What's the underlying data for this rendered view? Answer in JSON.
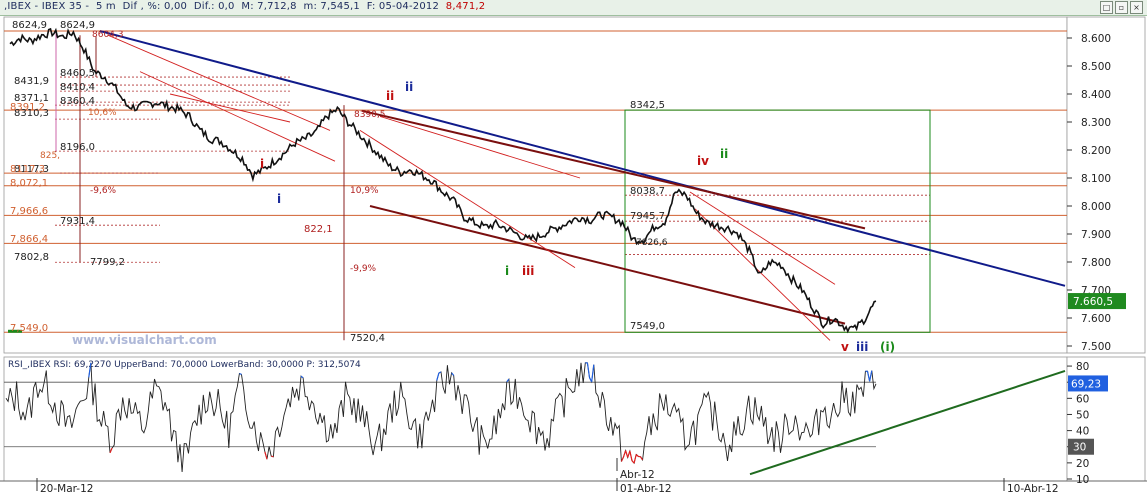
{
  "header": {
    "symbol": ",IBEX - IBEX 35 -",
    "interval": "5 m",
    "dif_label": "Dif , %:",
    "dif_pct": "0,00",
    "dif_abs_label": "Dif.:",
    "dif_abs": "0,0",
    "max_label": "M:",
    "max": "7,712,8",
    "min_label": "m:",
    "min": "7,545,1",
    "date_label": "F:",
    "date": "05-04-2012",
    "f_value": "8,471,2",
    "window_buttons": [
      "□",
      "▫",
      "×"
    ]
  },
  "watermark": "www.visualchart.com",
  "colors": {
    "price_line": "#111111",
    "downtrend_blue": "#101b8a",
    "channel_dark_red": "#7a0f0f",
    "thin_red": "#d22020",
    "fib_line": "#d06030",
    "box_green": "#1a8a1a",
    "rsi_up": "#2060e0",
    "rsi_down": "#e02020",
    "rsi_trend": "#1f6b1f",
    "last_price_badge": "#1f8a1f"
  },
  "price_panel": {
    "y_ticks": [
      "8.600",
      "8.500",
      "8.400",
      "8.300",
      "8.200",
      "8.100",
      "8.000",
      "7.900",
      "7.800",
      "7.700",
      "7.600",
      "7.500"
    ],
    "last_price": "7.660,5",
    "level_labels": [
      "8624,9",
      "8624,9",
      "8604,3",
      "8460,5",
      "8431,9",
      "8410,4",
      "8371,1",
      "8360,4",
      "8391,2",
      "8310,3",
      "10,6%",
      "8342,5",
      "8196,0",
      "825,",
      "8117,3",
      "8117,3",
      "8,072,1",
      "-9,6%",
      "10,9%",
      "8038,7",
      "7,966,6",
      "7931,4",
      "7945,7",
      "7,866,4",
      "822,1",
      "7826,6",
      "7802,8",
      "7799,2",
      "-9,9%",
      "7,549,0",
      "7549,0",
      "7520,4",
      "8390,5"
    ],
    "wave_labels": [
      "ii",
      "ii",
      "i",
      "i",
      "iv",
      "ii",
      "i",
      "iii",
      "v",
      "iii",
      "(i)"
    ]
  },
  "rsi_panel": {
    "title": "RSI_,IBEX RSI: 69,2270 UpperBand: 70,0000 LowerBand: 30,0000 P: 312,5074",
    "y_ticks": [
      "80",
      "70",
      "60",
      "50",
      "40",
      "30",
      "20",
      "10"
    ],
    "rsi_value_badge": "69,23",
    "lower_band_badge": "30"
  },
  "time_axis": {
    "labels": [
      "20-Mar-12",
      "Abr-12",
      "01-Abr-12",
      "10-Abr-12"
    ]
  },
  "chart_data": [
    {
      "type": "line",
      "title": "IBEX 35 - 5 m",
      "xlabel": "",
      "ylabel": "",
      "ylim": [
        7480,
        8660
      ],
      "x": [
        "20-Mar-12",
        "",
        "",
        "",
        "",
        "",
        "",
        "",
        "",
        "",
        "",
        "",
        "",
        "",
        "",
        "",
        "",
        "",
        "",
        "",
        "",
        "",
        "",
        "",
        "",
        "",
        "",
        "",
        "",
        "",
        "",
        "",
        "",
        "",
        "",
        "",
        "",
        "",
        "",
        "",
        "",
        "",
        "01-Abr-12",
        "",
        "",
        "",
        "",
        "",
        "",
        "",
        "",
        "",
        "",
        "",
        "",
        "",
        "",
        "",
        "",
        "",
        "",
        "",
        "",
        "",
        "",
        "",
        "",
        "",
        "",
        "",
        "",
        "",
        "",
        "",
        "",
        "",
        "05-04-2012"
      ],
      "series": [
        {
          "values": [
            8580,
            8600,
            8590,
            8610,
            8620,
            8604,
            8620,
            8560,
            8480,
            8460,
            8420,
            8360,
            8350,
            8365,
            8370,
            8355,
            8345,
            8320,
            8270,
            8240,
            8230,
            8200,
            8170,
            8110,
            8130,
            8160,
            8190,
            8225,
            8240,
            8265,
            8320,
            8345,
            8300,
            8260,
            8220,
            8180,
            8140,
            8120,
            8130,
            8110,
            8090,
            8050,
            8020,
            7960,
            7940,
            7925,
            7935,
            7920,
            7900,
            7880,
            7890,
            7910,
            7925,
            7945,
            7960,
            7950,
            7970,
            7960,
            7940,
            7880,
            7880,
            7925,
            7945,
            8050,
            8040,
            7975,
            7940,
            7930,
            7920,
            7900,
            7840,
            7750,
            7800,
            7790,
            7740,
            7700,
            7640,
            7580,
            7600,
            7570,
            7560,
            7600,
            7660
          ]
        }
      ],
      "trendlines": [
        {
          "name": "downtrend",
          "from": [
            8620,
            "20-Mar-12"
          ],
          "to": [
            7720,
            "10-Abr-12"
          ]
        },
        {
          "name": "channel-top",
          "from": [
            8340,
            ""
          ],
          "to": [
            7920,
            ""
          ]
        },
        {
          "name": "channel-bottom",
          "from": [
            8000,
            ""
          ],
          "to": [
            7580,
            ""
          ]
        }
      ],
      "horizontal_levels": [
        8624.9,
        8342.5,
        8117.3,
        8072.1,
        7966.6,
        7866.4,
        7549.0
      ],
      "grid": false
    },
    {
      "type": "line",
      "title": "RSI_,IBEX RSI: 69,2270 UpperBand: 70,0000 LowerBand: 30,0000 P: 312,5074",
      "ylim": [
        10,
        85
      ],
      "upper_band": 70,
      "lower_band": 30,
      "last_value": 69.227,
      "series": [
        {
          "name": "RSI",
          "values": [
            55,
            62,
            48,
            70,
            66,
            52,
            40,
            58,
            72,
            45,
            35,
            60,
            50,
            42,
            65,
            58,
            30,
            22,
            48,
            62,
            55,
            40,
            68,
            52,
            33,
            28,
            50,
            64,
            70,
            58,
            45,
            38,
            60,
            55,
            42,
            30,
            47,
            62,
            50,
            36,
            52,
            68,
            75,
            60,
            45,
            30,
            40,
            58,
            66,
            54,
            42,
            35,
            52,
            64,
            76,
            80,
            62,
            45,
            30,
            18,
            28,
            46,
            58,
            48,
            36,
            42,
            55,
            46,
            32,
            40,
            56,
            50,
            38,
            35,
            48,
            42,
            36,
            55,
            50,
            62,
            58,
            68,
            69
          ]
        }
      ],
      "trendlines": [
        {
          "name": "rsi-uptrend",
          "from": [
            13,
            ""
          ],
          "to": [
            75,
            "10-Abr-12"
          ]
        }
      ],
      "grid": false
    }
  ]
}
